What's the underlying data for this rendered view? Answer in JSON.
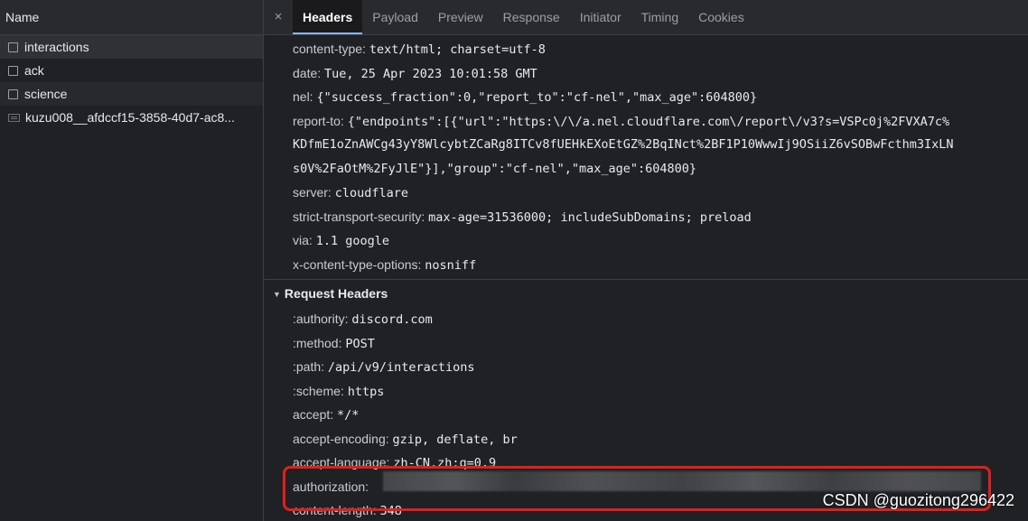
{
  "left_panel": {
    "header": "Name",
    "items": [
      {
        "label": "interactions"
      },
      {
        "label": "ack"
      },
      {
        "label": "science"
      },
      {
        "label": "kuzu008__afdccf15-3858-40d7-ac8..."
      }
    ]
  },
  "tabs": {
    "close": "×",
    "items": [
      "Headers",
      "Payload",
      "Preview",
      "Response",
      "Initiator",
      "Timing",
      "Cookies"
    ],
    "active": "Headers"
  },
  "response_headers": [
    {
      "key": "content-type:",
      "value": "text/html; charset=utf-8"
    },
    {
      "key": "date:",
      "value": "Tue, 25 Apr 2023 10:01:58 GMT"
    },
    {
      "key": "nel:",
      "value": "{\"success_fraction\":0,\"report_to\":\"cf-nel\",\"max_age\":604800}"
    },
    {
      "key": "report-to:",
      "value": "{\"endpoints\":[{\"url\":\"https:\\/\\/a.nel.cloudflare.com\\/report\\/v3?s=VSPc0j%2FVXA7c%"
    }
  ],
  "report_to_continuation": [
    "KDfmE1oZnAWCg43yY8WlcybtZCaRg8ITCv8fUEHkEXoEtGZ%2BqINct%2BF1P10WwwIj9OSiiZ6vSOBwFcthm3IxLN",
    "s0V%2FaOtM%2FyJlE\"}],\"group\":\"cf-nel\",\"max_age\":604800}"
  ],
  "response_headers_2": [
    {
      "key": "server:",
      "value": "cloudflare"
    },
    {
      "key": "strict-transport-security:",
      "value": "max-age=31536000; includeSubDomains; preload"
    },
    {
      "key": "via:",
      "value": "1.1 google"
    },
    {
      "key": "x-content-type-options:",
      "value": "nosniff"
    }
  ],
  "request_section": {
    "title": "Request Headers",
    "toggle_icon": "triangle-down-icon"
  },
  "request_headers": [
    {
      "key": ":authority:",
      "value": "discord.com"
    },
    {
      "key": ":method:",
      "value": "POST"
    },
    {
      "key": ":path:",
      "value": "/api/v9/interactions"
    },
    {
      "key": ":scheme:",
      "value": "https"
    },
    {
      "key": "accept:",
      "value": "*/*"
    },
    {
      "key": "accept-encoding:",
      "value": "gzip, deflate, br"
    },
    {
      "key": "accept-language:",
      "value": "zh-CN,zh;q=0.9"
    },
    {
      "key": "authorization:",
      "value": ""
    },
    {
      "key": "content-length:",
      "value": "348"
    }
  ],
  "watermark": "CSDN @guozitong296422",
  "colors": {
    "highlight_box": "#e0201c",
    "active_tab_underline": "#8ab4f8"
  }
}
